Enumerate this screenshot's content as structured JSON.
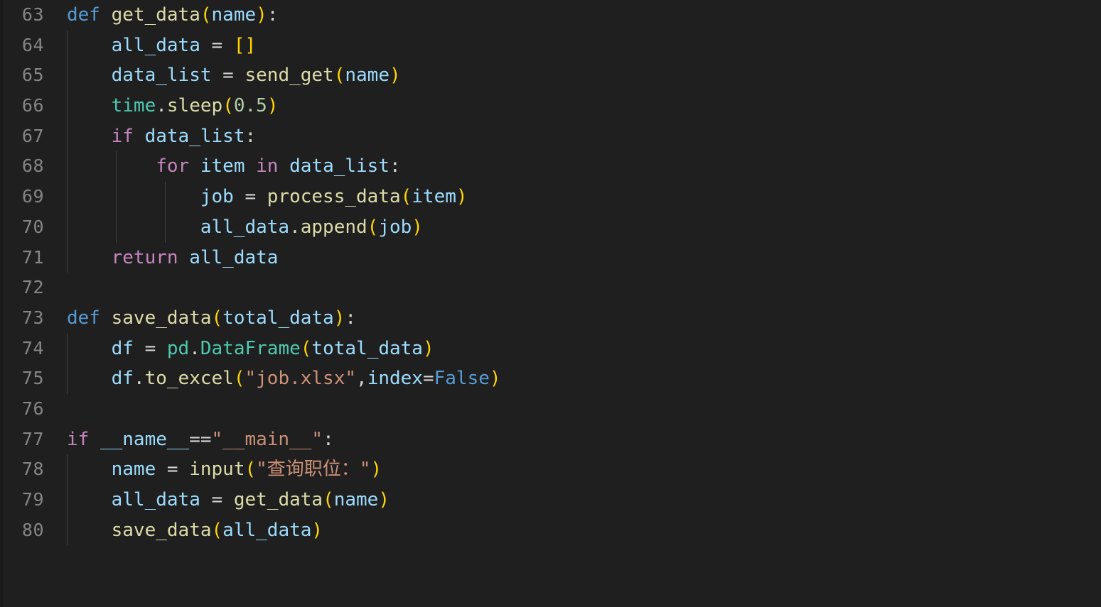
{
  "editor": {
    "language": "python",
    "theme": "dark-modern",
    "background_color": "#1f1f1f",
    "line_number_color": "#858585",
    "indent_guide_color": "#404040",
    "first_visible_line": 63,
    "last_visible_line": 80
  },
  "colors": {
    "keyword": "#569cd6",
    "control": "#c586c0",
    "function": "#dcdcaa",
    "variable": "#9cdcfe",
    "class": "#4ec9b0",
    "string": "#ce9178",
    "number": "#b5cea8",
    "operator": "#d4d4d4",
    "bracket1": "#ffd700",
    "bracket2": "#da70d6"
  },
  "lines": [
    {
      "n": "63",
      "guides": 0,
      "text": "def get_data(name):"
    },
    {
      "n": "64",
      "guides": 1,
      "text": "    all_data = []"
    },
    {
      "n": "65",
      "guides": 1,
      "text": "    data_list = send_get(name)"
    },
    {
      "n": "66",
      "guides": 1,
      "text": "    time.sleep(0.5)"
    },
    {
      "n": "67",
      "guides": 1,
      "text": "    if data_list:"
    },
    {
      "n": "68",
      "guides": 2,
      "text": "        for item in data_list:"
    },
    {
      "n": "69",
      "guides": 3,
      "text": "            job = process_data(item)"
    },
    {
      "n": "70",
      "guides": 3,
      "text": "            all_data.append(job)"
    },
    {
      "n": "71",
      "guides": 1,
      "text": "    return all_data"
    },
    {
      "n": "72",
      "guides": 0,
      "text": ""
    },
    {
      "n": "73",
      "guides": 0,
      "text": "def save_data(total_data):"
    },
    {
      "n": "74",
      "guides": 1,
      "text": "    df = pd.DataFrame(total_data)"
    },
    {
      "n": "75",
      "guides": 1,
      "text": "    df.to_excel(\"job.xlsx\",index=False)"
    },
    {
      "n": "76",
      "guides": 0,
      "text": ""
    },
    {
      "n": "77",
      "guides": 0,
      "text": "if __name__==\"__main__\":"
    },
    {
      "n": "78",
      "guides": 1,
      "text": "    name = input(\"查询职位：\")"
    },
    {
      "n": "79",
      "guides": 1,
      "text": "    all_data = get_data(name)"
    },
    {
      "n": "80",
      "guides": 1,
      "text": "    save_data(all_data)"
    }
  ],
  "code_html": [
    "<span class=\"kw\">def</span> <span class=\"fn\">get_data</span><span class=\"p1\">(</span><span class=\"var\">name</span><span class=\"p1\">)</span><span class=\"op\">:</span>",
    "    <span class=\"var\">all_data</span> <span class=\"op\">=</span> <span class=\"p1\">[]</span>",
    "    <span class=\"var\">data_list</span> <span class=\"op\">=</span> <span class=\"fn\">send_get</span><span class=\"p1\">(</span><span class=\"var\">name</span><span class=\"p1\">)</span>",
    "    <span class=\"cls\">time</span><span class=\"op\">.</span><span class=\"fn\">sleep</span><span class=\"p1\">(</span><span class=\"num\">0.5</span><span class=\"p1\">)</span>",
    "    <span class=\"ctl\">if</span> <span class=\"var\">data_list</span><span class=\"op\">:</span>",
    "        <span class=\"ctl\">for</span> <span class=\"var\">item</span> <span class=\"ctl\">in</span> <span class=\"var\">data_list</span><span class=\"op\">:</span>",
    "            <span class=\"var\">job</span> <span class=\"op\">=</span> <span class=\"fn\">process_data</span><span class=\"p1\">(</span><span class=\"var\">item</span><span class=\"p1\">)</span>",
    "            <span class=\"var\">all_data</span><span class=\"op\">.</span><span class=\"fn\">append</span><span class=\"p1\">(</span><span class=\"var\">job</span><span class=\"p1\">)</span>",
    "    <span class=\"ctl\">return</span> <span class=\"var\">all_data</span>",
    "",
    "<span class=\"kw\">def</span> <span class=\"fn\">save_data</span><span class=\"p1\">(</span><span class=\"var\">total_data</span><span class=\"p1\">)</span><span class=\"op\">:</span>",
    "    <span class=\"var\">df</span> <span class=\"op\">=</span> <span class=\"cls\">pd</span><span class=\"op\">.</span><span class=\"cls\">DataFrame</span><span class=\"p1\">(</span><span class=\"var\">total_data</span><span class=\"p1\">)</span>",
    "    <span class=\"var\">df</span><span class=\"op\">.</span><span class=\"fn\">to_excel</span><span class=\"p1\">(</span><span class=\"str\">&quot;job.xlsx&quot;</span><span class=\"op\">,</span><span class=\"var\">index</span><span class=\"op\">=</span><span class=\"kw\">False</span><span class=\"p1\">)</span>",
    "",
    "<span class=\"ctl\">if</span> <span class=\"var\">__name__</span><span class=\"op\">==</span><span class=\"str\">&quot;__main__&quot;</span><span class=\"op\">:</span>",
    "    <span class=\"var\">name</span> <span class=\"op\">=</span> <span class=\"fn\">input</span><span class=\"p1\">(</span><span class=\"str\">&quot;查询职位：&quot;</span><span class=\"p1\">)</span>",
    "    <span class=\"var\">all_data</span> <span class=\"op\">=</span> <span class=\"fn\">get_data</span><span class=\"p1\">(</span><span class=\"var\">name</span><span class=\"p1\">)</span>",
    "    <span class=\"fn\">save_data</span><span class=\"p1\">(</span><span class=\"var\">all_data</span><span class=\"p1\">)</span>"
  ]
}
